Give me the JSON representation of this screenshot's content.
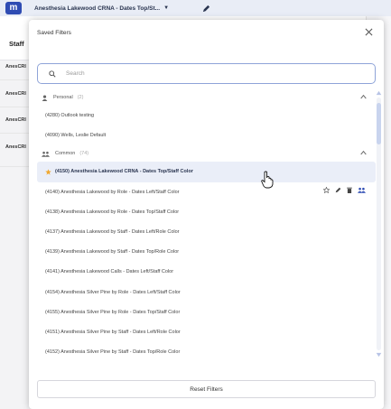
{
  "app": {
    "view_selector": "Anesthesia Lakewood CRNA - Dates Top/St...",
    "staff_header": "Staff",
    "rows": [
      "AnesCRI",
      "AnesCRI",
      "AnesCRI",
      "AnesCRI"
    ]
  },
  "modal": {
    "title": "Saved Filters",
    "search_placeholder": "Search",
    "reset_label": "Reset Filters",
    "personal": {
      "label": "Personal",
      "count": "(2)",
      "items": [
        "(4280) Outlook testing",
        "(4090) Wells, Leslie Default"
      ]
    },
    "common": {
      "label": "Common",
      "count": "(74)",
      "items": [
        "(4150) Anesthesia Lakewood CRNA - Dates Top/Staff Color",
        "(4140) Anesthesia Lakewood by Role - Dates Left/Staff Color",
        "(4138) Anesthesia Lakewood by Role - Dates Top/Staff Color",
        "(4137) Anesthesia Lakewood by Staff - Dates Left/Role Color",
        "(4139) Anesthesia Lakewood by Staff - Dates Top/Role Color",
        "(4141) Anesthesia Lakewood Calls - Dates Left/Staff Color",
        "(4154) Anesthesia Silver Pine by Role - Dates Left/Staff Color",
        "(4155) Anesthesia Silver Pine by Role - Dates Top/Staff Color",
        "(4151) Anesthesia Silver Pine by Staff - Dates Left/Role Color",
        "(4152) Anesthesia Silver Pine by Staff - Dates Top/Role Color"
      ]
    }
  },
  "colors": {
    "brand": "#2f4cb3",
    "accent_star": "#f0a830",
    "selected_bg": "#eaeef8"
  }
}
